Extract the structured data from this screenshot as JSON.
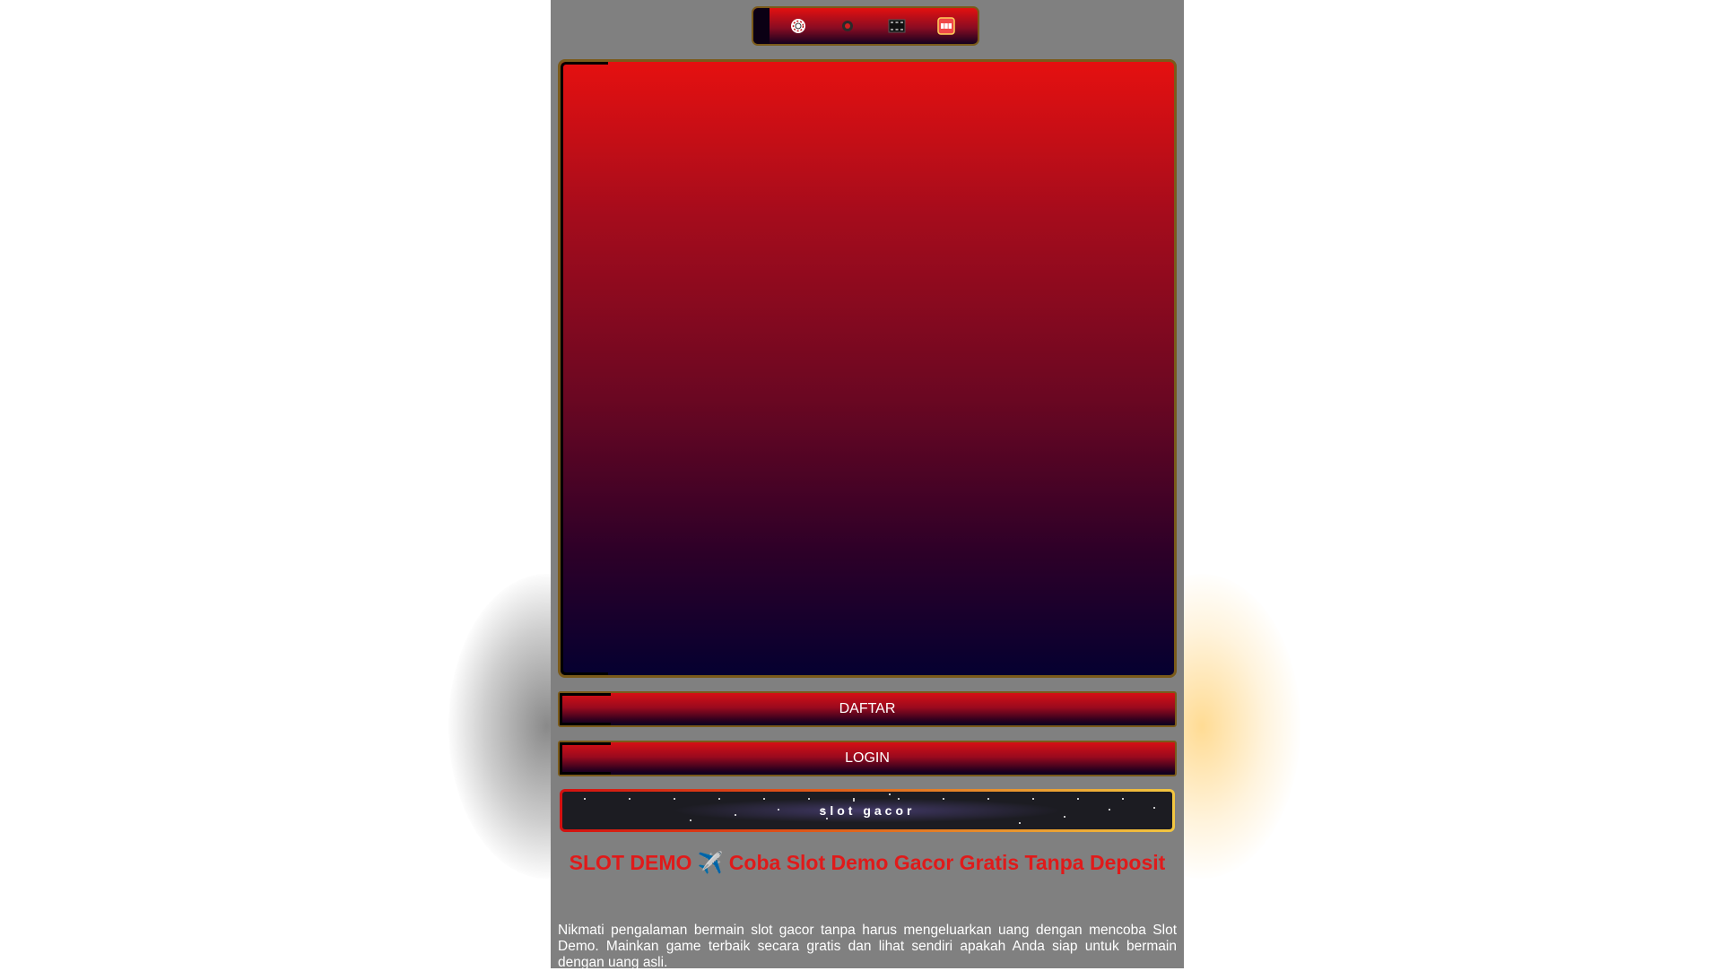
{
  "nav": {
    "items": [
      {
        "icon": "chip-icon"
      },
      {
        "icon": "record-icon"
      },
      {
        "icon": "film-icon"
      },
      {
        "icon": "slot-machine-icon"
      }
    ]
  },
  "buttons": {
    "daftar": "DAFTAR",
    "login": "LOGIN"
  },
  "marquee": {
    "text": "slot gacor"
  },
  "article": {
    "title": "SLOT DEMO ✈️ Coba Slot Demo Gacor Gratis Tanpa Deposit",
    "description": "Nikmati pengalaman bermain slot gacor tanpa harus mengeluarkan uang dengan mencoba Slot Demo. Mainkan game terbaik secara gratis dan lihat sendiri apakah Anda siap untuk bermain dengan uang asli."
  },
  "colors": {
    "page_bg": "#808080",
    "accent_red": "#e01a1a",
    "border_gold": "#7a5a1a",
    "marquee_gold": "#f2c640"
  }
}
